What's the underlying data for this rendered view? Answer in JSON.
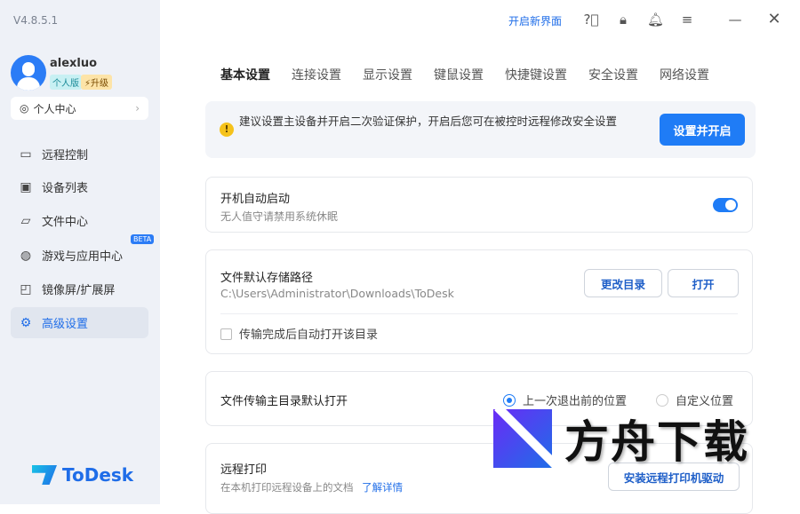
{
  "app": {
    "version": "V4.8.5.1",
    "logo_text": "ToDesk"
  },
  "user": {
    "name": "alexluo",
    "edition_badge": "个人版",
    "upgrade_badge": "⚡升级",
    "personal_center": "个人中心"
  },
  "sidebar": {
    "items": [
      {
        "label": "远程控制",
        "icon": "monitor-icon"
      },
      {
        "label": "设备列表",
        "icon": "devices-icon"
      },
      {
        "label": "文件中心",
        "icon": "folder-icon"
      },
      {
        "label": "游戏与应用中心",
        "icon": "gamepad-icon",
        "badge": "BETA"
      },
      {
        "label": "镜像屏/扩展屏",
        "icon": "cast-icon"
      },
      {
        "label": "高级设置",
        "icon": "gear-icon",
        "active": true
      }
    ]
  },
  "header": {
    "new_ui": "开启新界面"
  },
  "tabs": [
    "基本设置",
    "连接设置",
    "显示设置",
    "键鼠设置",
    "快捷键设置",
    "安全设置",
    "网络设置"
  ],
  "warning": {
    "text": "建议设置主设备并开启二次验证保护，开启后您可在被控时远程修改安全设置",
    "button": "设置并开启"
  },
  "autostart": {
    "title": "开机自动启动",
    "desc": "无人值守请禁用系统休眠",
    "enabled": true
  },
  "storage": {
    "title": "文件默认存储路径",
    "path": "C:\\Users\\Administrator\\Downloads\\ToDesk",
    "change_btn": "更改目录",
    "open_btn": "打开",
    "auto_open_label": "传输完成后自动打开该目录",
    "auto_open_checked": false
  },
  "transfer_dir": {
    "title": "文件传输主目录默认打开",
    "option1": "上一次退出前的位置",
    "option2": "自定义位置",
    "selected": "option1"
  },
  "print": {
    "title": "远程打印",
    "desc": "在本机打印远程设备上的文档",
    "link": "了解详情",
    "button": "安装远程打印机驱动"
  },
  "watermark": {
    "text": "方舟下载"
  }
}
